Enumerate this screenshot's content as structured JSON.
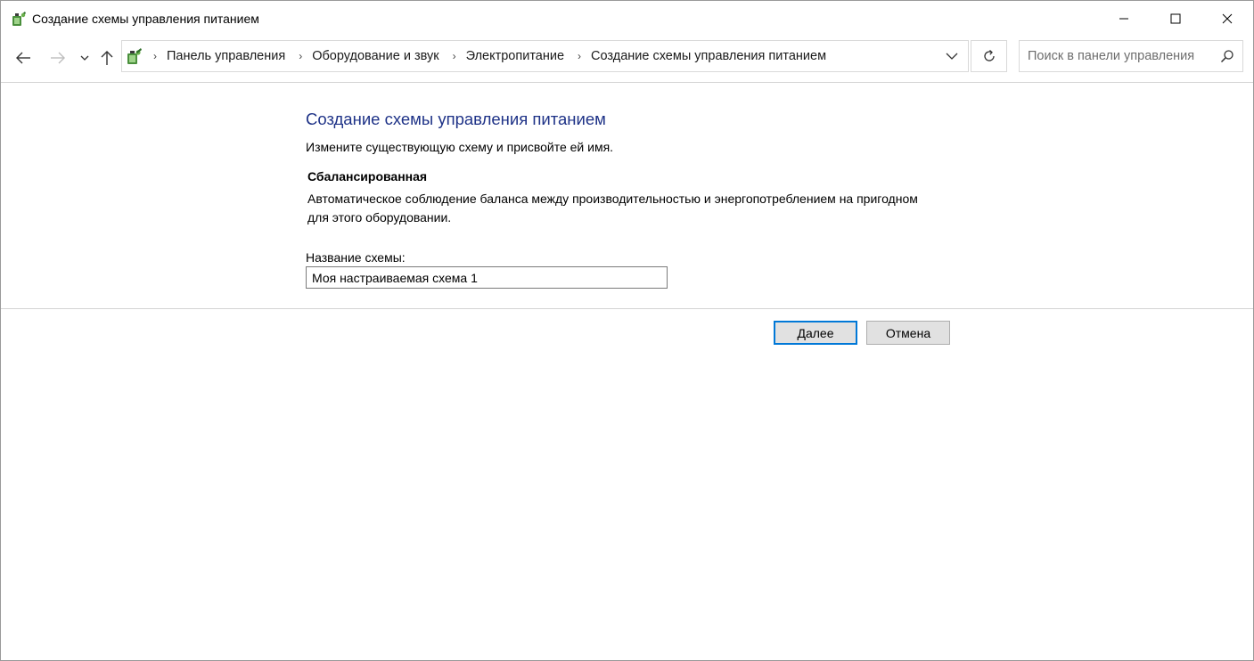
{
  "window": {
    "title": "Создание схемы управления питанием",
    "controls": [
      "minimize",
      "maximize",
      "close"
    ]
  },
  "nav": {
    "breadcrumbs": [
      "Панель управления",
      "Оборудование и звук",
      "Электропитание",
      "Создание схемы управления питанием"
    ],
    "search_placeholder": "Поиск в панели управления"
  },
  "content": {
    "title": "Создание схемы управления питанием",
    "subtitle": "Измените существующую схему и присвойте ей имя.",
    "plan_name": "Сбалансированная",
    "plan_description": "Автоматическое соблюдение баланса между производительностью и энергопотреблением на пригодном для этого оборудовании.",
    "field_label": "Название схемы:",
    "field_value": "Моя настраиваемая схема 1"
  },
  "buttons": {
    "next": "Далее",
    "cancel": "Отмена"
  },
  "colors": {
    "title_blue": "#1e3287",
    "focus_blue": "#0078d7"
  },
  "icons": {
    "app": "power-options-icon",
    "back": "arrow-left-icon",
    "forward": "arrow-right-icon",
    "recent": "chevron-down-icon",
    "up": "arrow-up-icon",
    "refresh": "refresh-icon",
    "search": "search-icon"
  }
}
